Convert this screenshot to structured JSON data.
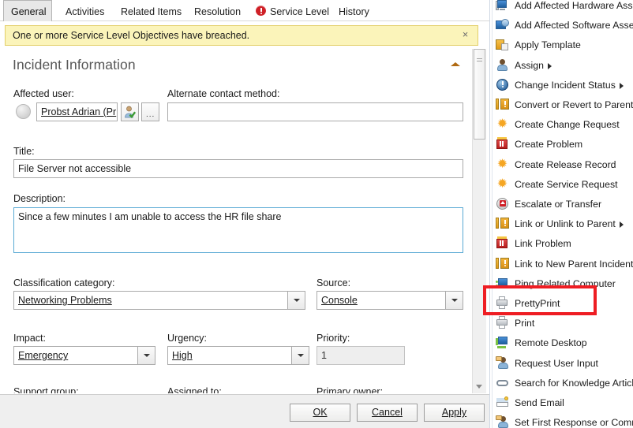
{
  "tabs": [
    {
      "label": "General",
      "active": true,
      "icon": null
    },
    {
      "label": "Activities",
      "active": false,
      "icon": null
    },
    {
      "label": "Related Items",
      "active": false,
      "icon": null
    },
    {
      "label": "Resolution",
      "active": false,
      "icon": null
    },
    {
      "label": "Service Level",
      "active": false,
      "icon": "error-icon"
    },
    {
      "label": "History",
      "active": false,
      "icon": null
    }
  ],
  "notice": {
    "text": "One or more Service Level Objectives have breached.",
    "close_label": "×",
    "background": "#fbf4ba",
    "border": "#e3cf6a"
  },
  "panel": {
    "title": "Incident Information",
    "collapse_icon": "chevron-up-icon"
  },
  "form": {
    "affected_user": {
      "label": "Affected user:",
      "value": "Probst Adrian (Pr",
      "picker_icon": "user-check-icon",
      "browse_label": "...",
      "avatar_icon": "avatar-icon"
    },
    "alternate_contact": {
      "label": "Alternate contact method:",
      "value": "",
      "placeholder": ""
    },
    "title": {
      "label": "Title:",
      "value": "File Server not accessible"
    },
    "description": {
      "label": "Description:",
      "value": "Since a few minutes I am unable to access the HR file share"
    },
    "classification": {
      "label": "Classification category:",
      "value": "Networking Problems"
    },
    "source": {
      "label": "Source:",
      "value": "Console"
    },
    "impact": {
      "label": "Impact:",
      "value": "Emergency"
    },
    "urgency": {
      "label": "Urgency:",
      "value": "High"
    },
    "priority": {
      "label": "Priority:",
      "value": "1",
      "readonly": true
    },
    "support_group": {
      "label": "Support group:"
    },
    "assigned_to": {
      "label": "Assigned to:"
    },
    "primary_owner": {
      "label": "Primary owner:"
    }
  },
  "footer": {
    "ok": "OK",
    "cancel": "Cancel",
    "apply": "Apply"
  },
  "scrollbar": {
    "down_icon": "scroll-down-icon"
  },
  "task_pane": {
    "items": [
      {
        "label": "Add Affected Hardware Asset",
        "icon": "hardware-asset-icon",
        "submenu": false
      },
      {
        "label": "Add Affected Software Asset",
        "icon": "software-asset-icon",
        "submenu": false
      },
      {
        "label": "Apply Template",
        "icon": "template-icon",
        "submenu": false
      },
      {
        "label": "Assign",
        "icon": "assign-user-icon",
        "submenu": true
      },
      {
        "label": "Change Incident Status",
        "icon": "status-info-icon",
        "submenu": true
      },
      {
        "label": "Convert or Revert to Parent",
        "icon": "parent-incident-icon",
        "submenu": false
      },
      {
        "label": "Create Change Request",
        "icon": "change-request-icon",
        "submenu": false
      },
      {
        "label": "Create Problem",
        "icon": "problem-icon",
        "submenu": false
      },
      {
        "label": "Create Release Record",
        "icon": "release-record-icon",
        "submenu": false
      },
      {
        "label": "Create Service Request",
        "icon": "service-request-icon",
        "submenu": false
      },
      {
        "label": "Escalate or Transfer",
        "icon": "escalate-icon",
        "submenu": false
      },
      {
        "label": "Link or Unlink to Parent",
        "icon": "parent-incident-icon",
        "submenu": true
      },
      {
        "label": "Link Problem",
        "icon": "problem-icon",
        "submenu": false
      },
      {
        "label": "Link to New Parent Incident",
        "icon": "parent-incident-icon",
        "submenu": false
      },
      {
        "label": "Ping Related Computer",
        "icon": "ping-computer-icon",
        "submenu": false
      },
      {
        "label": "PrettyPrint",
        "icon": "printer-icon",
        "submenu": false,
        "highlighted": true
      },
      {
        "label": "Print",
        "icon": "printer-icon",
        "submenu": false
      },
      {
        "label": "Remote Desktop",
        "icon": "remote-desktop-icon",
        "submenu": false
      },
      {
        "label": "Request User Input",
        "icon": "request-input-icon",
        "submenu": false
      },
      {
        "label": "Search for Knowledge Articles",
        "icon": "knowledge-search-icon",
        "submenu": false
      },
      {
        "label": "Send Email",
        "icon": "email-icon",
        "submenu": false
      },
      {
        "label": "Set First Response or Commen",
        "icon": "request-input-icon",
        "submenu": false
      }
    ],
    "highlight_color": "#ee1d23"
  }
}
